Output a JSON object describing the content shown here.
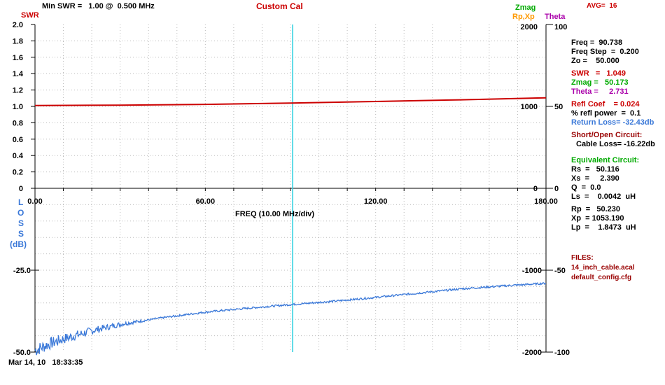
{
  "header": {
    "min_swr": "Min SWR =   1.00 @  0.500 MHz",
    "cal_mode": "Custom Cal",
    "avg": "AVG=  16",
    "swr_label": "SWR",
    "zmag_label": "Zmag",
    "rpxp_label": "Rp,Xp",
    "theta_label": "Theta"
  },
  "colors": {
    "swr": "#cc0000",
    "zmag": "#00aa00",
    "rpxp": "#ff9900",
    "theta": "#aa00aa",
    "loss": "#3a78d8",
    "marker": "#30d0e0",
    "dark_red": "#990000",
    "grid": "#bbbbbb"
  },
  "bottom_label": {
    "loss_letters": [
      "L",
      "O",
      "S",
      "S"
    ],
    "loss_unit": "(dB)",
    "freq_div": "FREQ (10.00 MHz/div)"
  },
  "timestamp": "Mar 14, 10   18:33:35",
  "readout": {
    "freq": "Freq =  90.738",
    "freq_step": "Freq Step  =  0.200",
    "zo": "Zo =    50.000",
    "swr": "SWR   =   1.049",
    "zmag": "Zmag =   50.173",
    "theta": "Theta =     2.731",
    "refl_coef": "Refl Coef    = 0.024",
    "refl_power": "% refl power  =  0.1",
    "return_loss": "Return Loss= -32.43db",
    "short_open": "Short/Open Circuit:",
    "cable_loss": "Cable Loss= -16.22db",
    "equiv_title": "Equivalent Circuit:",
    "rs": "Rs  =   50.116",
    "xs": "Xs  =     2.390",
    "q": "Q  =  0.0",
    "ls": "Ls  =    0.0042  uH",
    "rp": "Rp  =   50.230",
    "xp": "Xp  = 1053.190",
    "lp": "Lp  =    1.8473  uH"
  },
  "files": {
    "title": "FILES:",
    "file1": "14_inch_cable.acal",
    "file2": "default_config.cfg"
  },
  "chart_data": [
    {
      "type": "line",
      "name": "SWR plot",
      "x_ticks": [
        "0.00",
        "60.00",
        "120.00",
        "180.00"
      ],
      "x_range": [
        0,
        180
      ],
      "y_left": {
        "label": "SWR",
        "range": [
          0,
          2.0
        ],
        "ticks": [
          "2.0",
          "1.8",
          "1.6",
          "1.4",
          "1.2",
          "1.0",
          "0.8",
          "0.6",
          "0.4",
          "0.2",
          "0"
        ]
      },
      "y_right_zmag": {
        "range": [
          0,
          2000
        ],
        "ticks": [
          "2000",
          "1000",
          "0"
        ]
      },
      "y_right_theta": {
        "range": [
          0,
          100
        ],
        "ticks": [
          "100",
          "50",
          "0"
        ]
      },
      "marker_x": 90.738,
      "series": [
        {
          "name": "SWR",
          "x": [
            0,
            30,
            60,
            90,
            120,
            150,
            180
          ],
          "y": [
            1.01,
            1.015,
            1.025,
            1.04,
            1.06,
            1.08,
            1.105
          ]
        }
      ],
      "grid": true
    },
    {
      "type": "line",
      "name": "Loss plot",
      "x_range": [
        0,
        180
      ],
      "y_left": {
        "label": "LOSS (dB)",
        "range": [
          -50,
          0
        ],
        "ticks": [
          "-25.0",
          "-50.0"
        ]
      },
      "y_right_rpxp": {
        "range": [
          -2000,
          0
        ],
        "ticks": [
          "-1000",
          "-2000"
        ]
      },
      "y_right_theta": {
        "range": [
          -100,
          0
        ],
        "ticks": [
          "-50",
          "-100"
        ]
      },
      "marker_x": 90.738,
      "series": [
        {
          "name": "Return Loss",
          "x": [
            0,
            5,
            10,
            20,
            30,
            45,
            60,
            75,
            90,
            105,
            120,
            135,
            150,
            165,
            180
          ],
          "y": [
            -49.5,
            -47.5,
            -46.0,
            -43.5,
            -41.5,
            -39.5,
            -37.8,
            -36.6,
            -35.5,
            -34.5,
            -33.3,
            -32.0,
            -30.7,
            -29.8,
            -29.0
          ]
        }
      ],
      "grid": true
    }
  ]
}
